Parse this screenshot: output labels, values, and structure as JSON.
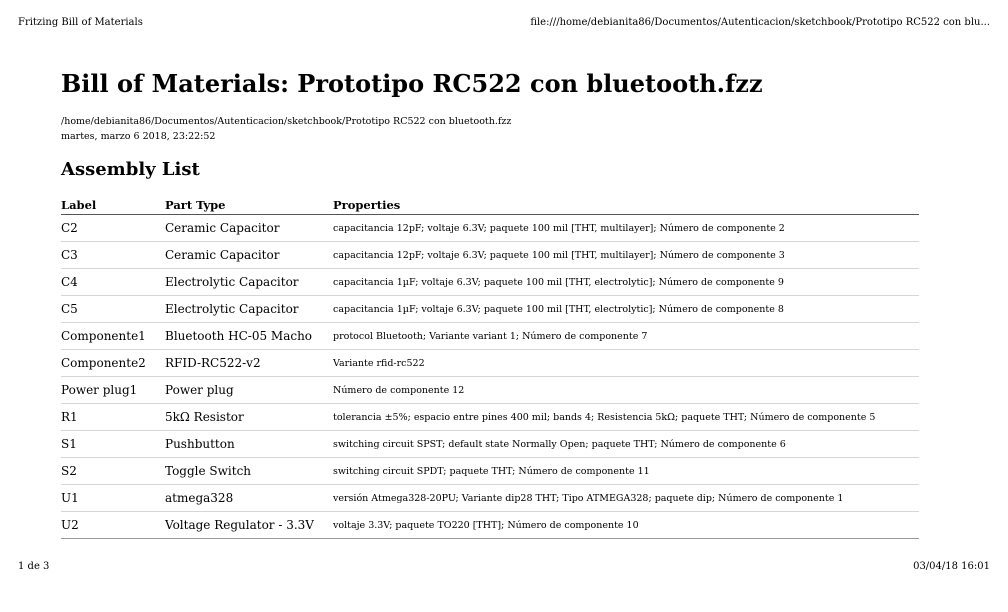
{
  "print_header": {
    "title": "Fritzing Bill of Materials",
    "url": "file:///home/debianita86/Documentos/Autenticacion/sketchbook/Prototipo RC522 con blu..."
  },
  "print_footer": {
    "page": "1 de 3",
    "datetime": "03/04/18 16:01"
  },
  "document": {
    "title": "Bill of Materials: Prototipo RC522 con bluetooth.fzz",
    "path": "/home/debianita86/Documentos/Autenticacion/sketchbook/Prototipo RC522 con bluetooth.fzz",
    "date": "martes, marzo 6 2018, 23:22:52",
    "section_title": "Assembly List"
  },
  "table": {
    "headers": [
      "Label",
      "Part Type",
      "Properties"
    ],
    "rows": [
      {
        "label": "C2",
        "part_type": "Ceramic Capacitor",
        "properties": "capacitancia 12pF; voltaje 6.3V; paquete 100 mil [THT, multilayer]; Número de componente 2"
      },
      {
        "label": "C3",
        "part_type": "Ceramic Capacitor",
        "properties": "capacitancia 12pF; voltaje 6.3V; paquete 100 mil [THT, multilayer]; Número de componente 3"
      },
      {
        "label": "C4",
        "part_type": "Electrolytic Capacitor",
        "properties": "capacitancia 1µF; voltaje 6.3V; paquete 100 mil [THT, electrolytic]; Número de componente 9"
      },
      {
        "label": "C5",
        "part_type": "Electrolytic Capacitor",
        "properties": "capacitancia 1µF; voltaje 6.3V; paquete 100 mil [THT, electrolytic]; Número de componente 8"
      },
      {
        "label": "Componente1",
        "part_type": "Bluetooth HC-05 Macho",
        "properties": "protocol Bluetooth; Variante variant 1; Número de componente 7"
      },
      {
        "label": "Componente2",
        "part_type": "RFID-RC522-v2",
        "properties": "Variante rfid-rc522"
      },
      {
        "label": "Power plug1",
        "part_type": "Power plug",
        "properties": "Número de componente 12"
      },
      {
        "label": "R1",
        "part_type": "5kΩ Resistor",
        "properties": "tolerancia ±5%; espacio entre pines 400 mil; bands 4; Resistencia 5kΩ; paquete THT; Número de componente 5"
      },
      {
        "label": "S1",
        "part_type": "Pushbutton",
        "properties": "switching circuit SPST; default state Normally Open; paquete THT; Número de componente 6"
      },
      {
        "label": "S2",
        "part_type": "Toggle Switch",
        "properties": "switching circuit SPDT; paquete THT; Número de componente 11"
      },
      {
        "label": "U1",
        "part_type": "atmega328",
        "properties": "versión Atmega328-20PU; Variante dip28 THT; Tipo ATMEGA328; paquete dip; Número de componente 1"
      },
      {
        "label": "U2",
        "part_type": "Voltage Regulator - 3.3V",
        "properties": "voltaje 3.3V; paquete TO220 [THT]; Número de componente 10"
      }
    ]
  }
}
